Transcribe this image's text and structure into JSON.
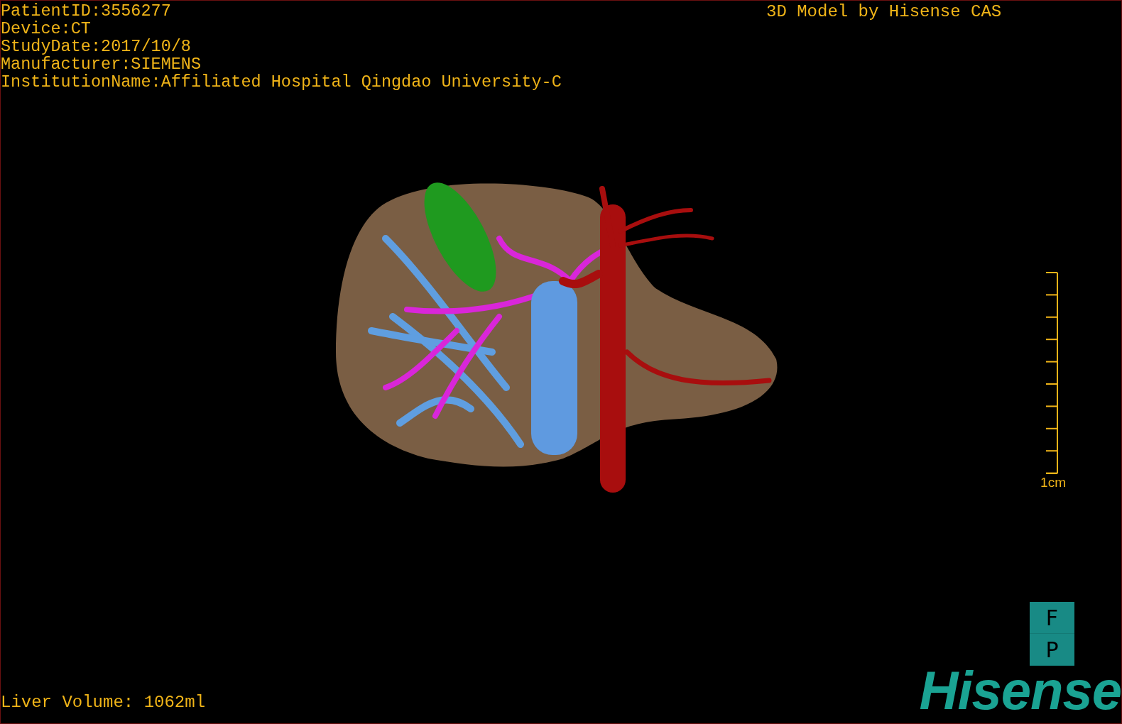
{
  "info_lines": [
    "PatientID:3556277",
    "Device:CT",
    "StudyDate:2017/10/8",
    "Manufacturer:SIEMENS",
    "InstitutionName:Affiliated Hospital Qingdao University-C"
  ],
  "title": "3D Model by Hisense CAS",
  "scale_bar": {
    "label": "1cm"
  },
  "orientation_marker": [
    "F",
    "P"
  ],
  "logo": "Hisense",
  "liver_volume": "Liver Volume: 1062ml"
}
